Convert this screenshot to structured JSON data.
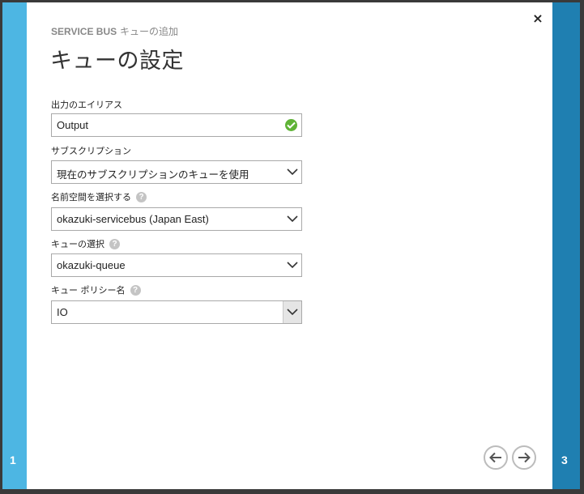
{
  "header": {
    "eyebrow_service": "SERVICE BUS",
    "eyebrow_action": "キューの追加",
    "title": "キューの設定",
    "close": "×"
  },
  "steps": {
    "left": "1",
    "right": "3"
  },
  "fields": {
    "output_alias": {
      "label": "出力のエイリアス",
      "value": "Output"
    },
    "subscription": {
      "label": "サブスクリプション",
      "value": "現在のサブスクリプションのキューを使用"
    },
    "namespace": {
      "label": "名前空間を選択する",
      "value": "okazuki-servicebus (Japan East)"
    },
    "queue": {
      "label": "キューの選択",
      "value": "okazuki-queue"
    },
    "policy": {
      "label": "キュー ポリシー名",
      "value": "IO"
    }
  },
  "help_glyph": "?",
  "icons": {
    "close": "close-icon",
    "check": "checkmark-icon",
    "chevron": "chevron-down-icon",
    "help": "help-icon",
    "prev": "arrow-left-icon",
    "next": "arrow-right-icon"
  },
  "colors": {
    "left_strip": "#4db6e3",
    "right_strip": "#1f7fb1",
    "valid": "#5fb336"
  }
}
